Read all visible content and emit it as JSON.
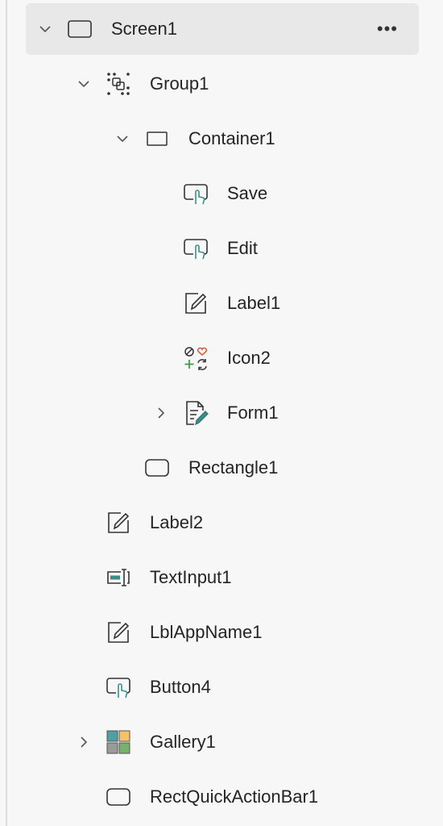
{
  "tree": {
    "items": [
      {
        "label": "Screen1",
        "icon": "screen-icon",
        "expander": "expanded",
        "selected": true,
        "more": "•••"
      },
      {
        "label": "Group1",
        "icon": "group-icon",
        "expander": "expanded"
      },
      {
        "label": "Container1",
        "icon": "container-icon",
        "expander": "expanded"
      },
      {
        "label": "Save",
        "icon": "button-icon"
      },
      {
        "label": "Edit",
        "icon": "button-icon"
      },
      {
        "label": "Label1",
        "icon": "label-icon"
      },
      {
        "label": "Icon2",
        "icon": "icons-icon"
      },
      {
        "label": "Form1",
        "icon": "form-icon",
        "expander": "collapsed"
      },
      {
        "label": "Rectangle1",
        "icon": "rectangle-icon"
      },
      {
        "label": "Label2",
        "icon": "label-icon"
      },
      {
        "label": "TextInput1",
        "icon": "text-input-icon"
      },
      {
        "label": "LblAppName1",
        "icon": "label-icon"
      },
      {
        "label": "Button4",
        "icon": "button-icon"
      },
      {
        "label": "Gallery1",
        "icon": "gallery-icon",
        "expander": "collapsed"
      },
      {
        "label": "RectQuickActionBar1",
        "icon": "rectangle-icon"
      }
    ]
  },
  "colors": {
    "accent": "#3a8d8a",
    "selected_bg": "#e8e8e8"
  }
}
